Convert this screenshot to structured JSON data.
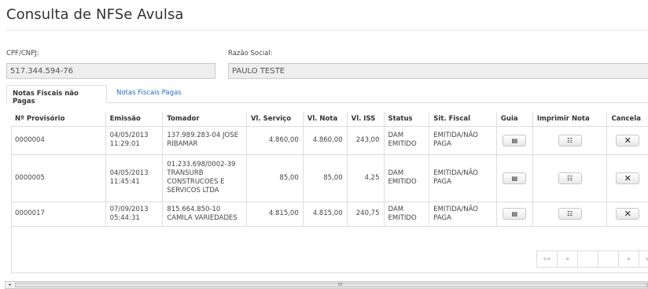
{
  "page": {
    "title": "Consulta de NFSe Avulsa"
  },
  "form": {
    "cpf_label": "CPF/CNPJ:",
    "cpf_value": "517.344.594-76",
    "razao_label": "Razão Social:",
    "razao_value": "PAULO TESTE"
  },
  "tabs": [
    {
      "label": "Notas Fiscais não Pagas",
      "active": true
    },
    {
      "label": "Notas Fiscais Pagas",
      "active": false
    }
  ],
  "table": {
    "headers": [
      "Nº Provisório",
      "Emissão",
      "Tomador",
      "Vl. Serviço",
      "Vl. Nota",
      "Vl. ISS",
      "Status",
      "Sit. Fiscal",
      "Guia",
      "Imprimir Nota",
      "Cancela"
    ],
    "rows": [
      {
        "provisorio": "0000004",
        "emissao": "04/05/2013 11:29:01",
        "tomador": "137.989.283-04 JOSE RIBAMAR",
        "vl_servico": "4.860,00",
        "vl_nota": "4.860,00",
        "vl_iss": "243,00",
        "status": "DAM EMITIDO",
        "sit_fiscal": "EMITIDA/NÃO PAGA"
      },
      {
        "provisorio": "0000005",
        "emissao": "04/05/2013 11:45:41",
        "tomador": "01.233.698/0002-39 TRANSURB CONSTRUCOES E SERVICOS LTDA",
        "vl_servico": "85,00",
        "vl_nota": "85,00",
        "vl_iss": "4,25",
        "status": "DAM EMITIDO",
        "sit_fiscal": "EMITIDA/NÃO PAGA"
      },
      {
        "provisorio": "0000017",
        "emissao": "07/09/2013 05:44:31",
        "tomador": "815.664.850-10 CAMILA VARIEDADES",
        "vl_servico": "4.815,00",
        "vl_nota": "4.815,00",
        "vl_iss": "240,75",
        "status": "DAM EMITIDO",
        "sit_fiscal": "EMITIDA/NÃO PAGA"
      }
    ],
    "icons": {
      "guia": "printer-icon",
      "imprimir": "document-icon",
      "cancela": "close-icon"
    }
  },
  "pager": {
    "first": "««",
    "prev": "«",
    "next": "»",
    "last": "»»"
  },
  "scrollbar": {
    "left_arrow": "◂",
    "grip": "III"
  }
}
